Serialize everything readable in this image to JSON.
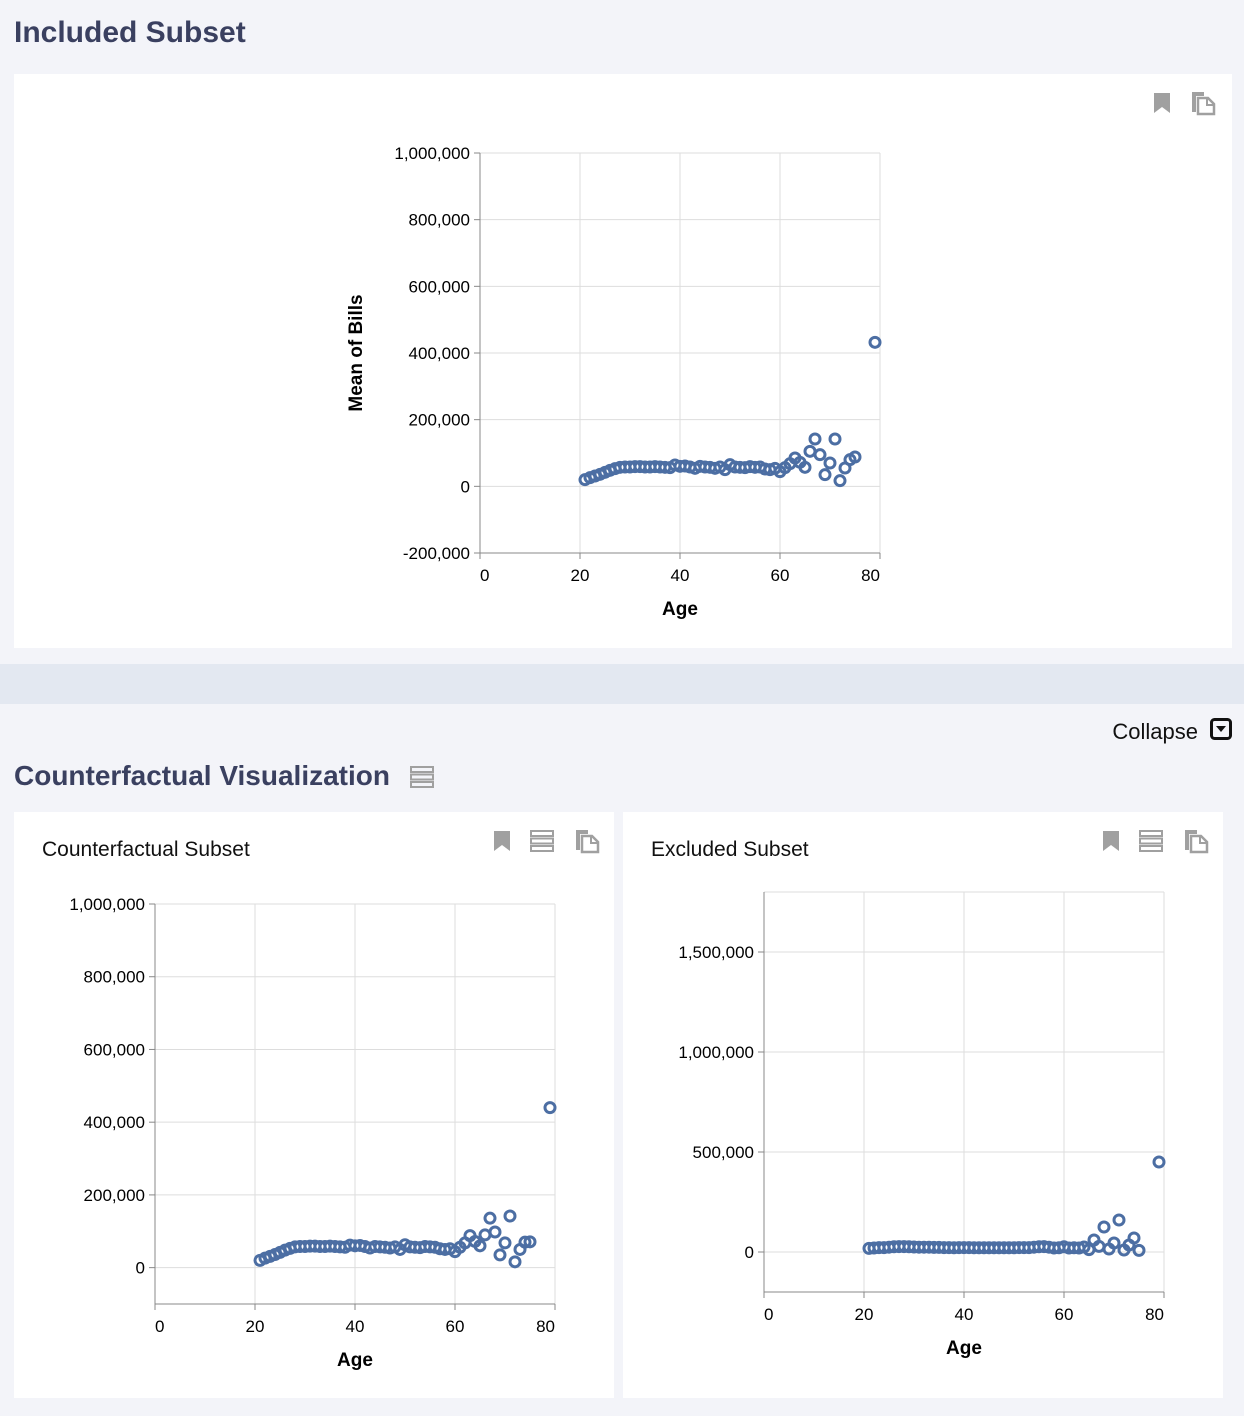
{
  "included": {
    "title": "Included Subset"
  },
  "counterfactual_section": {
    "title": "Counterfactual Visualization",
    "collapse_label": "Collapse"
  },
  "cards": {
    "counterfactual_title": "Counterfactual Subset",
    "excluded_title": "Excluded Subset"
  },
  "colors": {
    "point": "#4c6ea3",
    "title": "#3a4060",
    "icon": "#a0a0a0"
  },
  "chart_data": [
    {
      "id": "included",
      "type": "scatter",
      "xlabel": "Age",
      "ylabel": "Mean of Bills",
      "xlim": [
        0,
        80
      ],
      "ylim": [
        -200000,
        1000000
      ],
      "x_ticks": [
        0,
        20,
        40,
        60,
        80
      ],
      "y_ticks": [
        -200000,
        0,
        200000,
        400000,
        600000,
        800000,
        1000000
      ],
      "y_tick_labels": [
        "-200,000",
        "0",
        "200,000",
        "400,000",
        "600,000",
        "800,000",
        "1,000,000"
      ],
      "grid": true,
      "points": [
        [
          21,
          20000
        ],
        [
          22,
          26000
        ],
        [
          23,
          31000
        ],
        [
          24,
          36000
        ],
        [
          25,
          42000
        ],
        [
          26,
          48000
        ],
        [
          27,
          53000
        ],
        [
          28,
          57000
        ],
        [
          29,
          58000
        ],
        [
          30,
          58000
        ],
        [
          31,
          59000
        ],
        [
          32,
          59000
        ],
        [
          33,
          58000
        ],
        [
          34,
          58000
        ],
        [
          35,
          59000
        ],
        [
          36,
          58000
        ],
        [
          37,
          57000
        ],
        [
          38,
          56000
        ],
        [
          39,
          64000
        ],
        [
          40,
          60000
        ],
        [
          41,
          61000
        ],
        [
          42,
          58000
        ],
        [
          43,
          54000
        ],
        [
          44,
          60000
        ],
        [
          45,
          58000
        ],
        [
          46,
          57000
        ],
        [
          47,
          54000
        ],
        [
          48,
          58000
        ],
        [
          49,
          50000
        ],
        [
          50,
          65000
        ],
        [
          51,
          58000
        ],
        [
          52,
          57000
        ],
        [
          53,
          56000
        ],
        [
          54,
          59000
        ],
        [
          55,
          57000
        ],
        [
          56,
          58000
        ],
        [
          57,
          52000
        ],
        [
          58,
          50000
        ],
        [
          59,
          54000
        ],
        [
          60,
          44000
        ],
        [
          61,
          56000
        ],
        [
          62,
          68000
        ],
        [
          63,
          85000
        ],
        [
          64,
          72000
        ],
        [
          65,
          57000
        ],
        [
          66,
          105000
        ],
        [
          67,
          142000
        ],
        [
          68,
          95000
        ],
        [
          69,
          35000
        ],
        [
          70,
          70000
        ],
        [
          71,
          142000
        ],
        [
          72,
          17000
        ],
        [
          73,
          55000
        ],
        [
          74,
          80000
        ],
        [
          75,
          88000
        ],
        [
          79,
          432000
        ]
      ]
    },
    {
      "id": "counterfactual",
      "type": "scatter",
      "xlabel": "Age",
      "ylabel": "",
      "xlim": [
        0,
        80
      ],
      "ylim": [
        -100000,
        1000000
      ],
      "x_ticks": [
        0,
        20,
        40,
        60,
        80
      ],
      "y_ticks": [
        0,
        200000,
        400000,
        600000,
        800000,
        1000000
      ],
      "y_tick_labels": [
        "0",
        "200,000",
        "400,000",
        "600,000",
        "800,000",
        "1,000,000"
      ],
      "grid": true,
      "points": [
        [
          21,
          20000
        ],
        [
          22,
          26000
        ],
        [
          23,
          31000
        ],
        [
          24,
          36000
        ],
        [
          25,
          42000
        ],
        [
          26,
          48000
        ],
        [
          27,
          53000
        ],
        [
          28,
          57000
        ],
        [
          29,
          58000
        ],
        [
          30,
          58000
        ],
        [
          31,
          59000
        ],
        [
          32,
          59000
        ],
        [
          33,
          58000
        ],
        [
          34,
          58000
        ],
        [
          35,
          59000
        ],
        [
          36,
          58000
        ],
        [
          37,
          57000
        ],
        [
          38,
          56000
        ],
        [
          39,
          62000
        ],
        [
          40,
          60000
        ],
        [
          41,
          61000
        ],
        [
          42,
          58000
        ],
        [
          43,
          54000
        ],
        [
          44,
          58000
        ],
        [
          45,
          57000
        ],
        [
          46,
          56000
        ],
        [
          47,
          54000
        ],
        [
          48,
          57000
        ],
        [
          49,
          50000
        ],
        [
          50,
          63000
        ],
        [
          51,
          57000
        ],
        [
          52,
          56000
        ],
        [
          53,
          55000
        ],
        [
          54,
          58000
        ],
        [
          55,
          57000
        ],
        [
          56,
          56000
        ],
        [
          57,
          52000
        ],
        [
          58,
          50000
        ],
        [
          59,
          52000
        ],
        [
          60,
          44000
        ],
        [
          61,
          56000
        ],
        [
          62,
          68000
        ],
        [
          63,
          88000
        ],
        [
          64,
          72000
        ],
        [
          65,
          60000
        ],
        [
          66,
          90000
        ],
        [
          67,
          136000
        ],
        [
          68,
          98000
        ],
        [
          69,
          35000
        ],
        [
          70,
          68000
        ],
        [
          71,
          142000
        ],
        [
          72,
          16000
        ],
        [
          73,
          50000
        ],
        [
          74,
          70000
        ],
        [
          75,
          71000
        ],
        [
          79,
          440000
        ]
      ]
    },
    {
      "id": "excluded",
      "type": "scatter",
      "xlabel": "Age",
      "ylabel": "",
      "xlim": [
        0,
        80
      ],
      "ylim": [
        -200000,
        1800000
      ],
      "x_ticks": [
        0,
        20,
        40,
        60,
        80
      ],
      "y_ticks": [
        0,
        500000,
        1000000,
        1500000
      ],
      "y_tick_labels": [
        "0",
        "500,000",
        "1,000,000",
        "1,500,000"
      ],
      "grid": true,
      "points": [
        [
          21,
          18000
        ],
        [
          22,
          20000
        ],
        [
          23,
          22000
        ],
        [
          24,
          22000
        ],
        [
          25,
          24000
        ],
        [
          26,
          26000
        ],
        [
          27,
          27000
        ],
        [
          28,
          27000
        ],
        [
          29,
          26000
        ],
        [
          30,
          25000
        ],
        [
          31,
          24000
        ],
        [
          32,
          24000
        ],
        [
          33,
          24000
        ],
        [
          34,
          23000
        ],
        [
          35,
          23000
        ],
        [
          36,
          22000
        ],
        [
          37,
          22000
        ],
        [
          38,
          21000
        ],
        [
          39,
          22000
        ],
        [
          40,
          22000
        ],
        [
          41,
          22000
        ],
        [
          42,
          21000
        ],
        [
          43,
          21000
        ],
        [
          44,
          21000
        ],
        [
          45,
          21000
        ],
        [
          46,
          21000
        ],
        [
          47,
          21000
        ],
        [
          48,
          21000
        ],
        [
          49,
          21000
        ],
        [
          50,
          21000
        ],
        [
          51,
          22000
        ],
        [
          52,
          22000
        ],
        [
          53,
          22000
        ],
        [
          54,
          24000
        ],
        [
          55,
          26000
        ],
        [
          56,
          27000
        ],
        [
          57,
          24000
        ],
        [
          58,
          20000
        ],
        [
          59,
          21000
        ],
        [
          60,
          26000
        ],
        [
          61,
          20000
        ],
        [
          62,
          21000
        ],
        [
          63,
          20000
        ],
        [
          64,
          25000
        ],
        [
          65,
          12000
        ],
        [
          66,
          60000
        ],
        [
          67,
          28000
        ],
        [
          68,
          125000
        ],
        [
          69,
          15000
        ],
        [
          70,
          45000
        ],
        [
          71,
          160000
        ],
        [
          72,
          10000
        ],
        [
          73,
          35000
        ],
        [
          74,
          70000
        ],
        [
          75,
          8000
        ],
        [
          79,
          450000
        ]
      ]
    }
  ]
}
